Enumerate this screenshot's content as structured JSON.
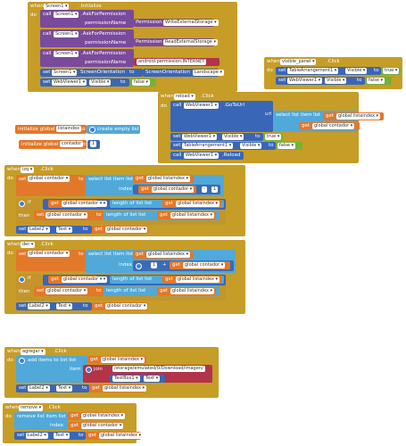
{
  "b1": {
    "when": "when",
    "comp": "Screen1",
    "ev": ".Initialize",
    "do": "do",
    "call": "call",
    "ask": ".AskForPermission",
    "permName": "permissionName",
    "perm1": "Permission",
    "perm1v": "WriteExternalStorage",
    "perm2": "Permission",
    "perm2v": "ReadExternalStorage",
    "perm3v": "android.permission.INTERNET",
    "set": "set",
    "so": "ScreenOrientation",
    "to": "to",
    "soLabel": "ScreenOrientation",
    "soVal": "Landscape",
    "wv": "WebViewer1",
    "vis": "Visible",
    "falseV": "false"
  },
  "b2": {
    "when": "when",
    "comp": "visible_panel",
    "ev": ".Click",
    "do": "do",
    "set": "set",
    "ta": "TableArrangement1",
    "vis": "Visible",
    "to": "to",
    "trueV": "true",
    "wv": "WebViewer1",
    "falseV": "false"
  },
  "b3": {
    "when": "when",
    "comp": "reload",
    "ev": ".Click",
    "do": "do",
    "call": "call",
    "wv": "WebViewer1",
    "goto": ".GoToUrl",
    "url": "url",
    "select": "select list item list",
    "get": "get",
    "gList": "global listaindex",
    "index": "index",
    "gCont": "global contador",
    "set": "set",
    "vis": "Visible",
    "to": "to",
    "trueV": "true",
    "ta": "TableArrangement1",
    "falseV": "false",
    "rel": ".Reload"
  },
  "g1": {
    "init": "initialize global",
    "name": "listaindex",
    "to": "to",
    "create": "create empty list"
  },
  "g2": {
    "init": "initialize global",
    "name": "contador",
    "to": "to",
    "num": "1"
  },
  "b4": {
    "when": "when",
    "comp": "izq",
    "ev": ".Click",
    "do": "do",
    "set": "set",
    "gCont": "global contador",
    "to": "to",
    "select": "select list item list",
    "get": "get",
    "gList": "global listaindex",
    "index": "index",
    "minus": "-",
    "one": "1",
    "if": "if",
    "eq": "=",
    "len": "length of list list",
    "then": "then",
    "label": "Label2",
    "text": "Text"
  },
  "b5": {
    "when": "when",
    "comp": "der",
    "ev": ".Click",
    "do": "do",
    "set": "set",
    "gCont": "global contador",
    "to": "to",
    "select": "select list item list",
    "get": "get",
    "gList": "global listaindex",
    "index": "index",
    "plus": "+",
    "one": "1",
    "if": "if",
    "gt": ">",
    "len": "length of list list",
    "then": "then",
    "label": "Label2",
    "text": "Text"
  },
  "b6": {
    "when": "when",
    "comp": "agregar",
    "ev": ".Click",
    "do": "do",
    "add": "add items to list list",
    "get": "get",
    "gList": "global listaindex",
    "item": "item",
    "join": "join",
    "path": "/storage/emulated/0/Download/imagen/",
    "tb": "TextBox1",
    "text": "Text",
    "set": "set",
    "label": "Label2",
    "to": "to"
  },
  "b7": {
    "when": "when",
    "comp": "remove",
    "ev": ".Click",
    "do": "do",
    "remove": "remove list item list",
    "get": "get",
    "gList": "global listaindex",
    "index": "index",
    "gCont": "global contador",
    "set": "set",
    "label": "Label2",
    "text": "Text",
    "to": "to"
  },
  "colors": {
    "event": "#c69d27",
    "procedure": "#7a4a9b",
    "component": "#3a66b7",
    "variable": "#e2782a",
    "list": "#50a9d9",
    "logic": "#72b33a",
    "text": "#b3334a",
    "math": "#3b6bb5"
  }
}
